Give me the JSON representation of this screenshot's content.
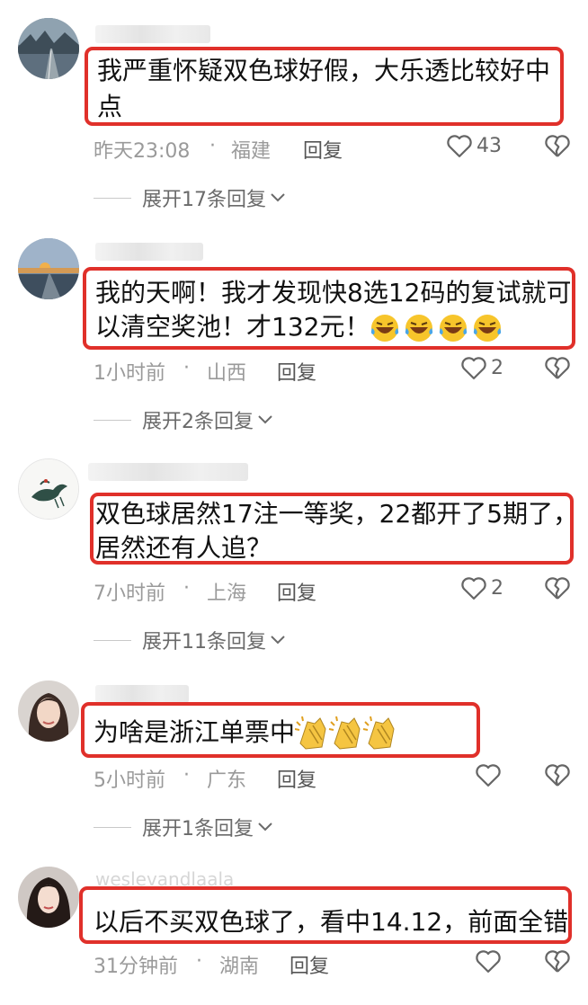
{
  "colors": {
    "highlight_border": "#e0302a",
    "meta_gray": "#9a9a9a"
  },
  "comments": [
    {
      "avatar_icon": "road-landscape-avatar",
      "text_lines": [
        "我严重怀疑双色球好假，大乐透比较好中",
        "点"
      ],
      "time": "昨天23:08",
      "sep": "·",
      "region": "福建",
      "reply_label": "回复",
      "like_count": "43",
      "expand_label": "展开17条回复"
    },
    {
      "avatar_icon": "sunset-road-avatar",
      "text_lines": [
        "我的天啊！我才发现快8选12码的复试就可",
        "以清空奖池！才132元！"
      ],
      "emoji": "laughing-tears-emoji",
      "emoji_count": 4,
      "time": "1小时前",
      "sep": "·",
      "region": "山西",
      "reply_label": "回复",
      "like_count": "2",
      "expand_label": "展开2条回复"
    },
    {
      "avatar_icon": "crane-ink-avatar",
      "text_lines": [
        "双色球居然17注一等奖，22都开了5期了，",
        "居然还有人追？"
      ],
      "time": "7小时前",
      "sep": "·",
      "region": "上海",
      "reply_label": "回复",
      "like_count": "2",
      "expand_label": "展开11条回复"
    },
    {
      "avatar_icon": "woman-portrait-avatar",
      "text_lines": [
        "为啥是浙江单票中"
      ],
      "emoji": "clapping-hands-emoji",
      "emoji_count": 3,
      "time": "5小时前",
      "sep": "·",
      "region": "广东",
      "reply_label": "回复",
      "like_count": "",
      "expand_label": "展开1条回复"
    },
    {
      "avatar_icon": "woman-portrait-2-avatar",
      "username_faint": "weslevandlaala",
      "text_lines": [
        "以后不买双色球了，看中14.12，前面全错"
      ],
      "time": "31分钟前",
      "sep": "·",
      "region": "湖南",
      "reply_label": "回复",
      "like_count": ""
    }
  ]
}
